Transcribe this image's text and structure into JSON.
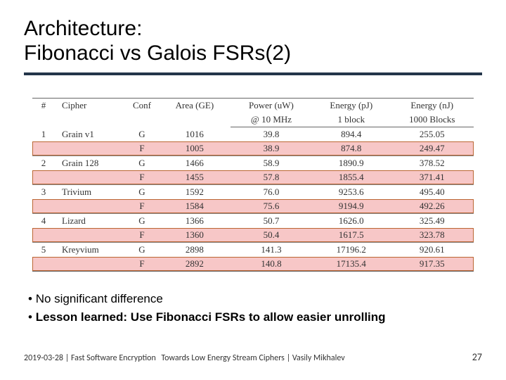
{
  "title_line1": "Architecture:",
  "title_line2": "Fibonacci vs Galois FSRs(2)",
  "headers": {
    "num": "#",
    "cipher": "Cipher",
    "conf": "Conf",
    "area": "Area (GE)",
    "power": "Power (uW)",
    "power_sub": "@ 10 MHz",
    "energy1": "Energy (pJ)",
    "energy1_sub": "1 block",
    "energy2": "Energy (nJ)",
    "energy2_sub": "1000 Blocks"
  },
  "rows": [
    {
      "num": "1",
      "cipher": "Grain v1",
      "conf": "G",
      "area": "1016",
      "power": "39.8",
      "e1": "894.4",
      "e2": "255.05"
    },
    {
      "num": "",
      "cipher": "",
      "conf": "F",
      "area": "1005",
      "power": "38.9",
      "e1": "874.8",
      "e2": "249.47"
    },
    {
      "num": "2",
      "cipher": "Grain 128",
      "conf": "G",
      "area": "1466",
      "power": "58.9",
      "e1": "1890.9",
      "e2": "378.52"
    },
    {
      "num": "",
      "cipher": "",
      "conf": "F",
      "area": "1455",
      "power": "57.8",
      "e1": "1855.4",
      "e2": "371.41"
    },
    {
      "num": "3",
      "cipher": "Trivium",
      "conf": "G",
      "area": "1592",
      "power": "76.0",
      "e1": "9253.6",
      "e2": "495.40"
    },
    {
      "num": "",
      "cipher": "",
      "conf": "F",
      "area": "1584",
      "power": "75.6",
      "e1": "9194.9",
      "e2": "492.26"
    },
    {
      "num": "4",
      "cipher": "Lizard",
      "conf": "G",
      "area": "1366",
      "power": "50.7",
      "e1": "1626.0",
      "e2": "325.49"
    },
    {
      "num": "",
      "cipher": "",
      "conf": "F",
      "area": "1360",
      "power": "50.4",
      "e1": "1617.5",
      "e2": "323.78"
    },
    {
      "num": "5",
      "cipher": "Kreyvium",
      "conf": "G",
      "area": "2898",
      "power": "141.3",
      "e1": "17196.2",
      "e2": "920.61"
    },
    {
      "num": "",
      "cipher": "",
      "conf": "F",
      "area": "2892",
      "power": "140.8",
      "e1": "17135.4",
      "e2": "917.35"
    }
  ],
  "bullets": {
    "b1": "No significant difference",
    "b2_prefix": "Lesson learned:",
    "b2_rest": " Use Fibonacci FSRs to allow easier unrolling"
  },
  "footer": {
    "left": "2019-03-28 | Fast Software Encryption",
    "center": "Towards Low Energy Stream Ciphers | Vasily Mikhalev",
    "page": "27"
  },
  "chart_data": {
    "type": "table",
    "title": "FSR architecture comparison (Galois vs Fibonacci)",
    "columns": [
      "#",
      "Cipher",
      "Conf",
      "Area (GE)",
      "Power (uW) @ 10 MHz",
      "Energy (pJ) 1 block",
      "Energy (nJ) 1000 Blocks"
    ],
    "rows": [
      [
        1,
        "Grain v1",
        "G",
        1016,
        39.8,
        894.4,
        255.05
      ],
      [
        1,
        "Grain v1",
        "F",
        1005,
        38.9,
        874.8,
        249.47
      ],
      [
        2,
        "Grain 128",
        "G",
        1466,
        58.9,
        1890.9,
        378.52
      ],
      [
        2,
        "Grain 128",
        "F",
        1455,
        57.8,
        1855.4,
        371.41
      ],
      [
        3,
        "Trivium",
        "G",
        1592,
        76.0,
        9253.6,
        495.4
      ],
      [
        3,
        "Trivium",
        "F",
        1584,
        75.6,
        9194.9,
        492.26
      ],
      [
        4,
        "Lizard",
        "G",
        1366,
        50.7,
        1626.0,
        325.49
      ],
      [
        4,
        "Lizard",
        "F",
        1360,
        50.4,
        1617.5,
        323.78
      ],
      [
        5,
        "Kreyvium",
        "G",
        2898,
        141.3,
        17196.2,
        920.61
      ],
      [
        5,
        "Kreyvium",
        "F",
        2892,
        140.8,
        17135.4,
        917.35
      ]
    ]
  }
}
